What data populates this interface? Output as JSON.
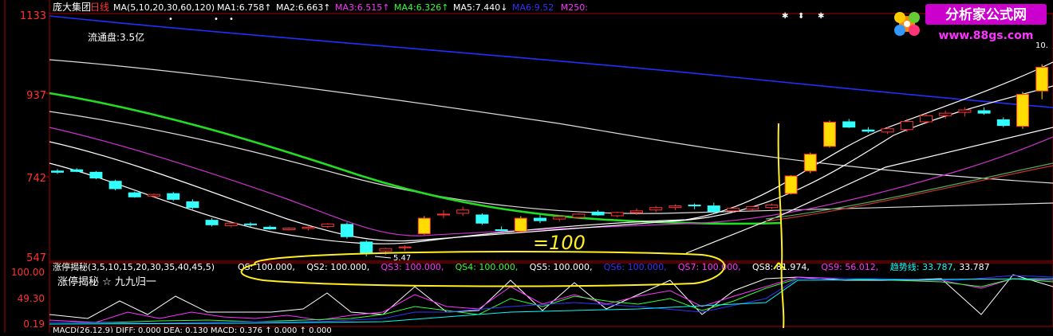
{
  "header": {
    "stock_name": "庞大集团",
    "period": "日线",
    "ma_spec": "MA(5,10,20,30,60,120)",
    "ma_items": [
      {
        "label": "MA1:",
        "value": "6.758",
        "arrow": "↑",
        "color": "#ffffff"
      },
      {
        "label": "MA2:",
        "value": "6.663",
        "arrow": "↑",
        "color": "#ffffff"
      },
      {
        "label": "MA3:",
        "value": "6.515",
        "arrow": "↑",
        "color": "#ff33ff"
      },
      {
        "label": "MA4:",
        "value": "6.326",
        "arrow": "↑",
        "color": "#33ff33"
      },
      {
        "label": "MA5:",
        "value": "7.440",
        "arrow": "↓",
        "color": "#ffffff"
      },
      {
        "label": "MA6:",
        "value": "9.52",
        "arrow": "",
        "color": "#3333ff"
      },
      {
        "label": "M250:",
        "value": "",
        "arrow": "",
        "color": "#ff33ff"
      }
    ]
  },
  "float_cap": "流通盘:3.5亿",
  "logo": {
    "title": "分析家公式网",
    "url": "www.88gs.com"
  },
  "price_axis": {
    "ticks": [
      "1133",
      "937",
      "742",
      "547"
    ]
  },
  "annotations": {
    "low_label": "5.47",
    "high_label": "10."
  },
  "indicator": {
    "title": "涨停揭秘(3,5,10,15,20,30,35,40,45,5)",
    "legend": [
      {
        "label": "QS:",
        "value": "100.000",
        "color": "#ffffff"
      },
      {
        "label": "QS2:",
        "value": "100.000",
        "color": "#ffffff"
      },
      {
        "label": "QS3:",
        "value": "100.000",
        "color": "#ff33ff"
      },
      {
        "label": "QS4:",
        "value": "100.000",
        "color": "#33ff33"
      },
      {
        "label": "QS5:",
        "value": "100.000",
        "color": "#ffffff"
      },
      {
        "label": "QS6:",
        "value": "100.000",
        "color": "#3333ff"
      },
      {
        "label": "QS7:",
        "value": "100.000",
        "color": "#ff33ff"
      },
      {
        "label": "QS8:",
        "value": "81.974",
        "color": "#ffffff"
      },
      {
        "label": "QS9:",
        "value": "56.012",
        "color": "#ff33ff"
      },
      {
        "label": "趋势线:",
        "value": "33.787",
        "color": "#00ffff"
      },
      {
        "label": "",
        "value": "33.787",
        "color": "#ffffff"
      }
    ],
    "caption": "涨停揭秘 ☆ 九九归一",
    "axis_ticks": [
      "100.00",
      "49.30",
      "0.19"
    ]
  },
  "macd": {
    "text": "MACD(26,12,9) DIFF: 0.000 DEA: 0.130 MACD: 0.376 ↑ 0.000 ↑ 0.000"
  },
  "handwritten_note": "=100",
  "chart_data": {
    "type": "candlestick",
    "ylim": [
      5.47,
      11.33
    ],
    "ohlc": [
      [
        7.55,
        7.6,
        7.48,
        7.52
      ],
      [
        7.58,
        7.62,
        7.52,
        7.54
      ],
      [
        7.52,
        7.55,
        7.35,
        7.38
      ],
      [
        7.3,
        7.34,
        7.08,
        7.12
      ],
      [
        7.02,
        7.05,
        6.9,
        6.92
      ],
      [
        6.94,
        7.0,
        6.9,
        6.98
      ],
      [
        7.0,
        7.04,
        6.82,
        6.86
      ],
      [
        6.8,
        6.86,
        6.62,
        6.66
      ],
      [
        6.35,
        6.4,
        6.2,
        6.24
      ],
      [
        6.22,
        6.3,
        6.18,
        6.28
      ],
      [
        6.26,
        6.3,
        6.2,
        6.24
      ],
      [
        6.18,
        6.22,
        6.12,
        6.14
      ],
      [
        6.12,
        6.18,
        6.1,
        6.16
      ],
      [
        6.15,
        6.2,
        6.1,
        6.18
      ],
      [
        6.2,
        6.28,
        6.16,
        6.26
      ],
      [
        6.25,
        6.3,
        5.9,
        5.95
      ],
      [
        5.82,
        5.86,
        5.47,
        5.55
      ],
      [
        5.6,
        5.68,
        5.5,
        5.66
      ],
      [
        5.68,
        5.74,
        5.6,
        5.7
      ],
      [
        6.02,
        6.45,
        6.0,
        6.4
      ],
      [
        6.48,
        6.6,
        6.4,
        6.5
      ],
      [
        6.52,
        6.68,
        6.46,
        6.6
      ],
      [
        6.48,
        6.52,
        6.24,
        6.28
      ],
      [
        6.12,
        6.2,
        6.08,
        6.1
      ],
      [
        6.08,
        6.45,
        6.04,
        6.4
      ],
      [
        6.4,
        6.48,
        6.28,
        6.34
      ],
      [
        6.38,
        6.48,
        6.32,
        6.44
      ],
      [
        6.42,
        6.52,
        6.38,
        6.5
      ],
      [
        6.55,
        6.6,
        6.46,
        6.48
      ],
      [
        6.46,
        6.56,
        6.42,
        6.54
      ],
      [
        6.54,
        6.64,
        6.48,
        6.58
      ],
      [
        6.6,
        6.7,
        6.55,
        6.66
      ],
      [
        6.66,
        6.74,
        6.6,
        6.7
      ],
      [
        6.72,
        6.76,
        6.62,
        6.7
      ],
      [
        6.7,
        6.78,
        6.52,
        6.56
      ],
      [
        6.58,
        6.66,
        6.54,
        6.64
      ],
      [
        6.62,
        6.7,
        6.58,
        6.68
      ],
      [
        6.66,
        6.76,
        6.62,
        6.72
      ],
      [
        7.0,
        7.45,
        6.98,
        7.43
      ],
      [
        7.55,
        8.0,
        7.5,
        7.96
      ],
      [
        8.15,
        8.78,
        8.12,
        8.74
      ],
      [
        8.75,
        8.82,
        8.6,
        8.62
      ],
      [
        8.55,
        8.62,
        8.48,
        8.52
      ],
      [
        8.5,
        8.62,
        8.45,
        8.58
      ],
      [
        8.56,
        8.82,
        8.5,
        8.76
      ],
      [
        8.75,
        8.95,
        8.7,
        8.9
      ],
      [
        8.9,
        9.02,
        8.82,
        8.96
      ],
      [
        8.98,
        9.1,
        8.88,
        9.04
      ],
      [
        9.02,
        9.1,
        8.92,
        8.96
      ],
      [
        8.8,
        8.86,
        8.62,
        8.66
      ],
      [
        8.64,
        9.48,
        8.58,
        9.42
      ],
      [
        9.5,
        10.15,
        9.3,
        10.08
      ]
    ]
  }
}
